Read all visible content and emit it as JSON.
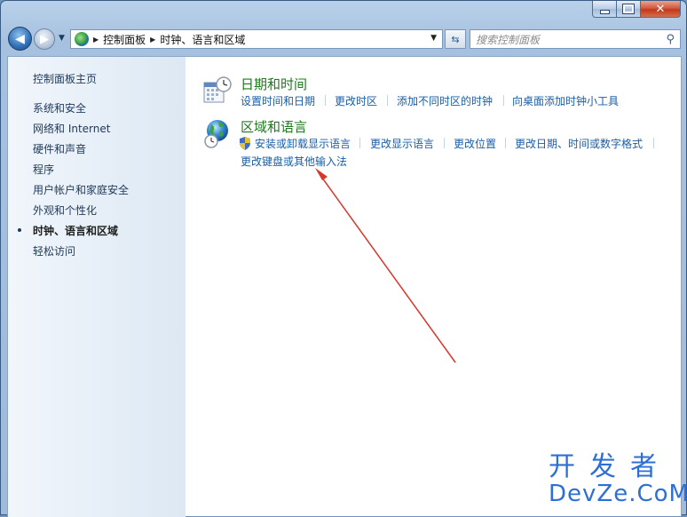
{
  "window": {
    "caption_icons": [
      "minimize-icon",
      "maximize-icon",
      "close-icon"
    ]
  },
  "nav": {
    "breadcrumbs": [
      "控制面板",
      "时钟、语言和区域"
    ],
    "search_placeholder": "搜索控制面板"
  },
  "sidebar": {
    "items": [
      {
        "label": "控制面板主页",
        "active": false
      },
      {
        "label": "系统和安全",
        "active": false
      },
      {
        "label": "网络和 Internet",
        "active": false
      },
      {
        "label": "硬件和声音",
        "active": false
      },
      {
        "label": "程序",
        "active": false
      },
      {
        "label": "用户帐户和家庭安全",
        "active": false
      },
      {
        "label": "外观和个性化",
        "active": false
      },
      {
        "label": "时钟、语言和区域",
        "active": true
      },
      {
        "label": "轻松访问",
        "active": false
      }
    ]
  },
  "main": {
    "categories": [
      {
        "title": "日期和时间",
        "icon": "calendar-clock-icon",
        "links": [
          "设置时间和日期",
          "更改时区",
          "添加不同时区的时钟",
          "向桌面添加时钟小工具"
        ]
      },
      {
        "title": "区域和语言",
        "icon": "globe-clock-icon",
        "links": [
          "安装或卸载显示语言",
          "更改显示语言",
          "更改位置",
          "更改日期、时间或数字格式",
          "更改键盘或其他输入法"
        ]
      }
    ]
  },
  "annotation": {
    "color": "#d9352b"
  },
  "watermark": {
    "line1": "开发者",
    "line2": "DevZe.CoM",
    "color": "#2e6fd6"
  }
}
